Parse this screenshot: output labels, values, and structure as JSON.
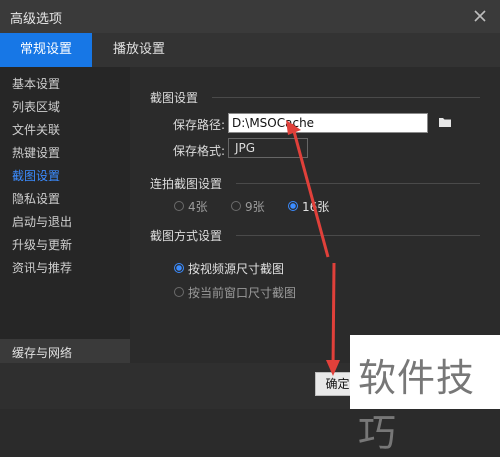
{
  "window": {
    "title": "高级选项",
    "close_icon": "close-icon"
  },
  "tabs": [
    {
      "label": "常规设置",
      "active": true
    },
    {
      "label": "播放设置",
      "active": false
    }
  ],
  "sidebar": {
    "items": [
      {
        "label": "基本设置",
        "active": false
      },
      {
        "label": "列表区域",
        "active": false
      },
      {
        "label": "文件关联",
        "active": false
      },
      {
        "label": "热键设置",
        "active": false
      },
      {
        "label": "截图设置",
        "active": true
      },
      {
        "label": "隐私设置",
        "active": false
      },
      {
        "label": "启动与退出",
        "active": false
      },
      {
        "label": "升级与更新",
        "active": false
      },
      {
        "label": "资讯与推荐",
        "active": false
      }
    ],
    "bottom_item": "缓存与网络"
  },
  "main": {
    "screenshot_settings": {
      "title": "截图设置",
      "save_path_label": "保存路径:",
      "save_path_value": "D:\\MSOCache",
      "folder_icon": "folder-icon",
      "save_format_label": "保存格式:",
      "save_format_value": "JPG"
    },
    "burst_settings": {
      "title": "连拍截图设置",
      "options": [
        {
          "label": "4张",
          "checked": false
        },
        {
          "label": "9张",
          "checked": false
        },
        {
          "label": "16张",
          "checked": true
        }
      ]
    },
    "capture_mode": {
      "title": "截图方式设置",
      "options": [
        {
          "label": "按视频源尺寸截图",
          "checked": true
        },
        {
          "label": "按当前窗口尺寸截图",
          "checked": false
        }
      ]
    }
  },
  "footer": {
    "ok_label": "确定"
  },
  "watermark": {
    "text": "软件技巧"
  },
  "annotations": {
    "arrow_color": "#e0403a"
  },
  "colors": {
    "accent": "#1777e6",
    "highlight": "#3b8cff",
    "background": "#2b2b2b"
  }
}
